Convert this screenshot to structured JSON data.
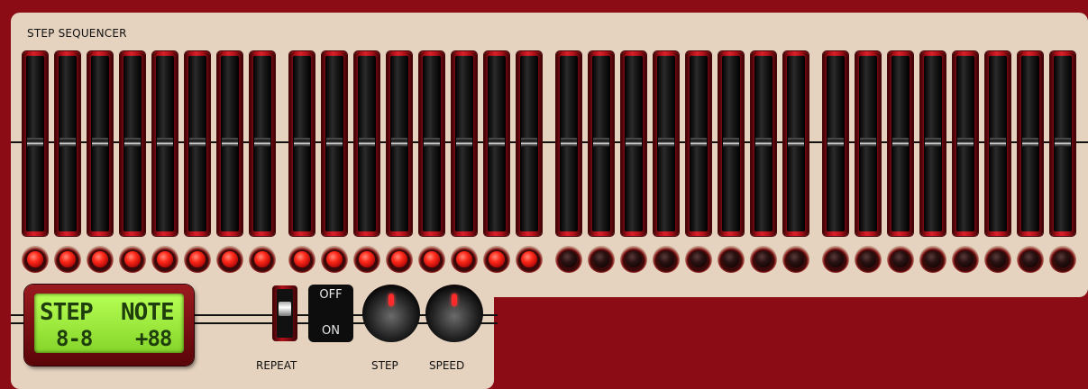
{
  "panel": {
    "title": "STEP SEQUENCER"
  },
  "steps": [
    {
      "active": true
    },
    {
      "active": true
    },
    {
      "active": true
    },
    {
      "active": true
    },
    {
      "active": true
    },
    {
      "active": true
    },
    {
      "active": true
    },
    {
      "active": true
    },
    {
      "active": true
    },
    {
      "active": true
    },
    {
      "active": true
    },
    {
      "active": true
    },
    {
      "active": true
    },
    {
      "active": true
    },
    {
      "active": true
    },
    {
      "active": true
    },
    {
      "active": false
    },
    {
      "active": false
    },
    {
      "active": false
    },
    {
      "active": false
    },
    {
      "active": false
    },
    {
      "active": false
    },
    {
      "active": false
    },
    {
      "active": false
    },
    {
      "active": false
    },
    {
      "active": false
    },
    {
      "active": false
    },
    {
      "active": false
    },
    {
      "active": false
    },
    {
      "active": false
    },
    {
      "active": false
    },
    {
      "active": false
    }
  ],
  "slider_level": 0.5,
  "display": {
    "step_label": "STEP",
    "note_label": "NOTE",
    "step_value": "8-8",
    "note_value": "+88"
  },
  "repeat": {
    "label": "REPEAT",
    "off_label": "OFF",
    "on_label": "ON"
  },
  "knobs": {
    "step_label": "STEP",
    "speed_label": "SPEED"
  },
  "colors": {
    "led_on": "#ff2a1a",
    "lcd": "#a6f04a",
    "panel": "#e6d3bf",
    "frame": "#8b0c14"
  }
}
